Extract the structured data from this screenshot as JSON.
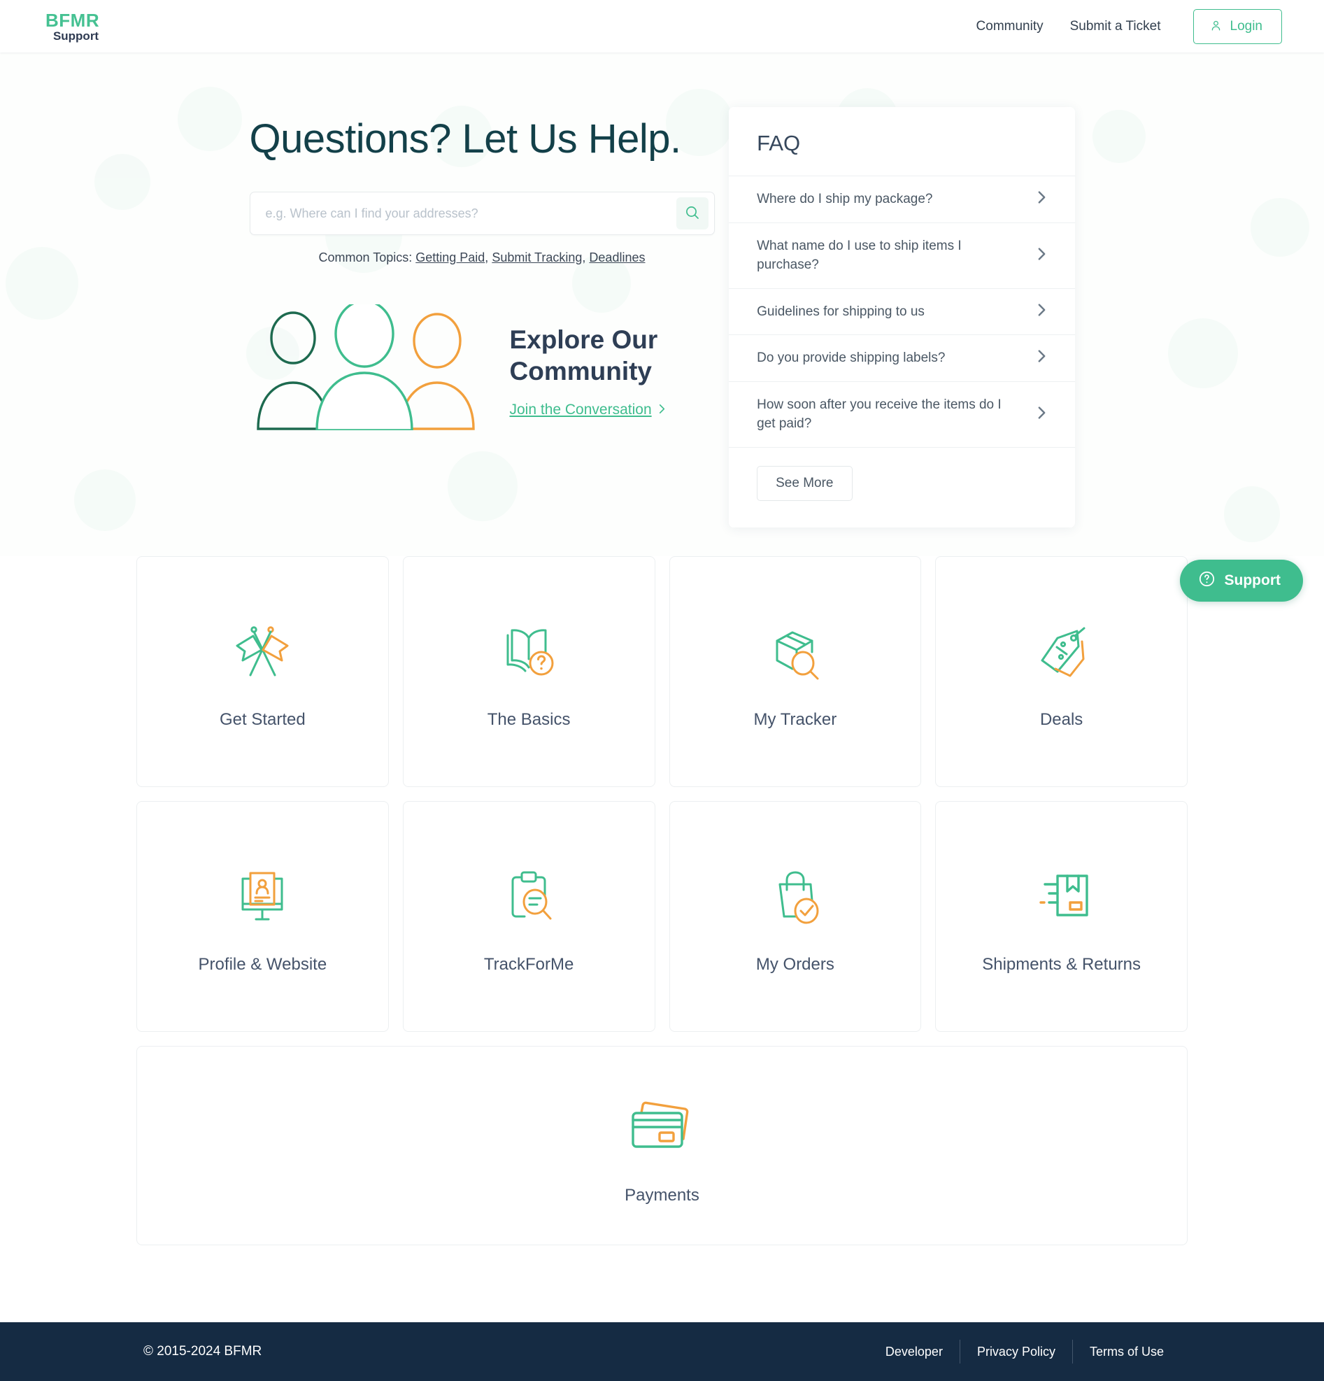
{
  "brand": {
    "logo_main": "BFMR",
    "logo_sub": "Support"
  },
  "header": {
    "nav": [
      {
        "label": "Community"
      },
      {
        "label": "Submit a Ticket"
      }
    ],
    "login_label": "Login",
    "login_icon": "user-icon"
  },
  "hero": {
    "title": "Questions? Let Us Help.",
    "search": {
      "placeholder": "e.g. Where can I find your addresses?",
      "value": "",
      "button_icon": "search-icon"
    },
    "common_topics_label": "Common Topics:",
    "common_topics": [
      {
        "label": "Getting Paid"
      },
      {
        "label": "Submit Tracking"
      },
      {
        "label": "Deadlines"
      }
    ]
  },
  "community": {
    "title": "Explore Our Community",
    "link_label": "Join the Conversation",
    "illustration": "three-people-icon"
  },
  "faq": {
    "title": "FAQ",
    "items": [
      {
        "question": "Where do I ship my package?"
      },
      {
        "question": "What name do I use to ship items I purchase?"
      },
      {
        "question": "Guidelines for shipping to us"
      },
      {
        "question": "Do you provide shipping labels?"
      },
      {
        "question": "How soon after you receive the items do I get paid?"
      }
    ],
    "see_more_label": "See More"
  },
  "categories": {
    "row1": [
      {
        "label": "Get Started",
        "icon": "crossed-flags-icon"
      },
      {
        "label": "The Basics",
        "icon": "open-book-question-icon"
      },
      {
        "label": "My Tracker",
        "icon": "box-magnifier-icon"
      },
      {
        "label": "Deals",
        "icon": "price-tag-percent-icon"
      }
    ],
    "row2": [
      {
        "label": "Profile & Website",
        "icon": "monitor-profile-icon"
      },
      {
        "label": "TrackForMe",
        "icon": "clipboard-magnifier-icon"
      },
      {
        "label": "My Orders",
        "icon": "shopping-bag-check-icon"
      },
      {
        "label": "Shipments & Returns",
        "icon": "package-shipping-icon"
      }
    ],
    "row3": [
      {
        "label": "Payments",
        "icon": "credit-cards-icon"
      }
    ]
  },
  "support_widget": {
    "label": "Support",
    "icon": "question-circle-icon"
  },
  "footer": {
    "copyright": "© 2015-2024 BFMR",
    "links": [
      {
        "label": "Developer"
      },
      {
        "label": "Privacy Policy"
      },
      {
        "label": "Terms of Use"
      }
    ]
  },
  "colors": {
    "green": "#3fbd8e",
    "green_dark": "#1d6a4f",
    "orange": "#f2a03d",
    "heading_teal": "#134049",
    "navy": "#152b43",
    "text": "#45536a"
  }
}
